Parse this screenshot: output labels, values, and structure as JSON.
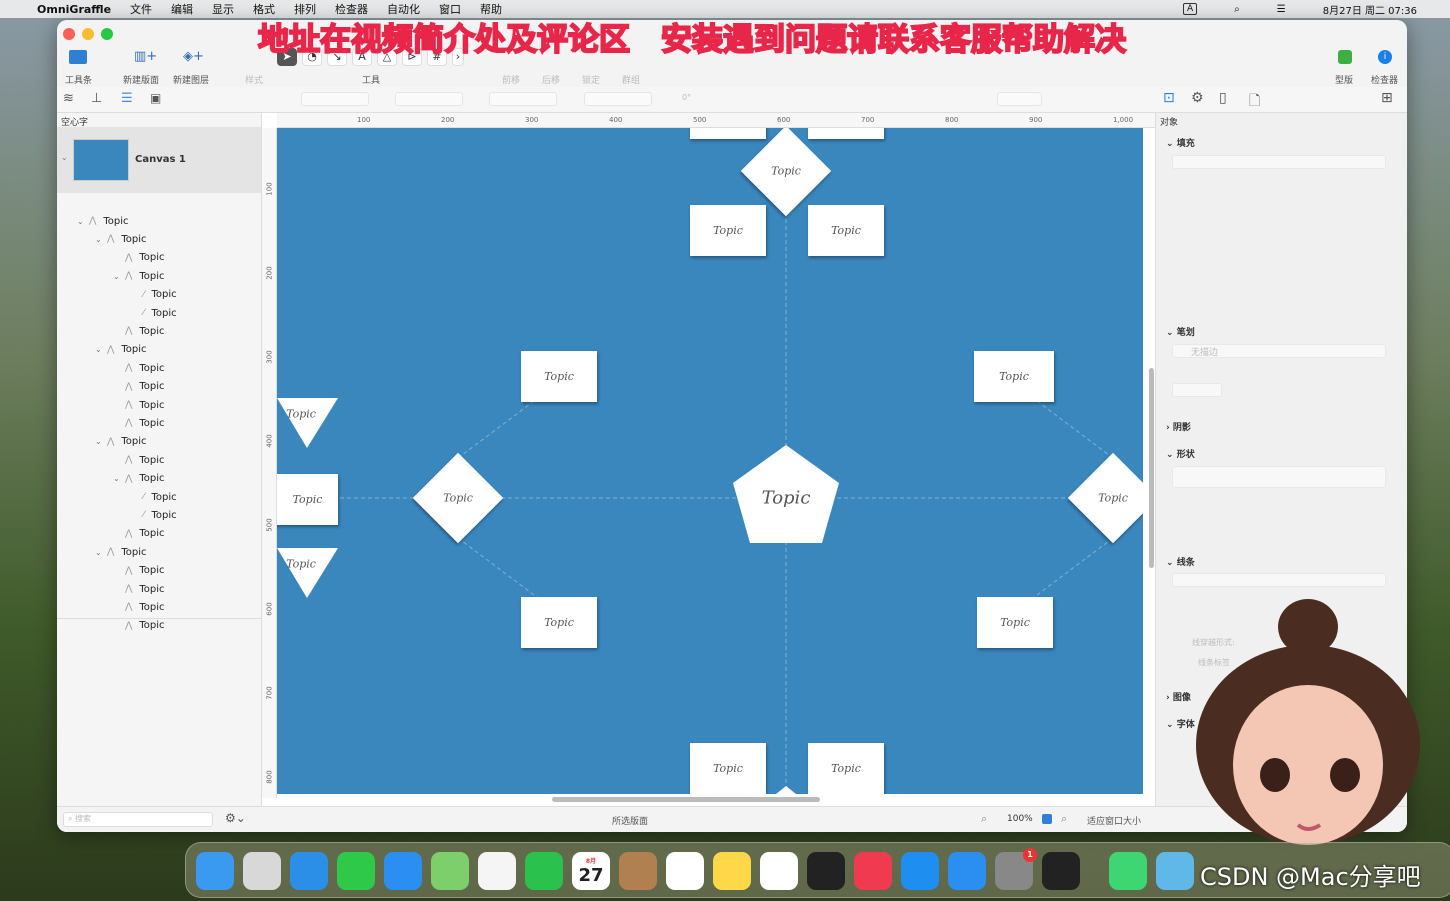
{
  "menubar": {
    "app": "OmniGraffle",
    "items": [
      "文件",
      "编辑",
      "显示",
      "格式",
      "排列",
      "检查器",
      "自动化",
      "窗口",
      "帮助"
    ],
    "input_indicator": "A",
    "datetime": "8月27日 周二 07:36"
  },
  "banner": "地址在视频简介处及评论区　安装遇到问题请联系客服帮助解决",
  "toolbar": {
    "toolbar_label": "工具条",
    "new_canvas": "新建版面",
    "new_layer": "新建图层",
    "style": "样式",
    "tools": "工具",
    "forward": "前移",
    "backward": "后移",
    "lock": "锁定",
    "group": "群组",
    "templates": "型版",
    "inspector": "检查器"
  },
  "subbar": {
    "angle": "0°"
  },
  "sidebar": {
    "title": "空心字",
    "canvas_name": "Canvas 1",
    "outline": [
      {
        "label": "Topic",
        "level": 0,
        "open": true
      },
      {
        "label": "Topic",
        "level": 1,
        "open": true
      },
      {
        "label": "Topic",
        "level": 2
      },
      {
        "label": "Topic",
        "level": 2,
        "open": true
      },
      {
        "label": "Topic",
        "level": 3
      },
      {
        "label": "Topic",
        "level": 3
      },
      {
        "label": "Topic",
        "level": 2
      },
      {
        "label": "Topic",
        "level": 1,
        "open": true
      },
      {
        "label": "Topic",
        "level": 2
      },
      {
        "label": "Topic",
        "level": 2
      },
      {
        "label": "Topic",
        "level": 2
      },
      {
        "label": "Topic",
        "level": 2
      },
      {
        "label": "Topic",
        "level": 1,
        "open": true
      },
      {
        "label": "Topic",
        "level": 2
      },
      {
        "label": "Topic",
        "level": 2,
        "open": true
      },
      {
        "label": "Topic",
        "level": 3
      },
      {
        "label": "Topic",
        "level": 3
      },
      {
        "label": "Topic",
        "level": 2
      },
      {
        "label": "Topic",
        "level": 1,
        "open": true
      },
      {
        "label": "Topic",
        "level": 2
      },
      {
        "label": "Topic",
        "level": 2
      },
      {
        "label": "Topic",
        "level": 2
      },
      {
        "label": "Topic",
        "level": 2
      }
    ]
  },
  "ruler": {
    "h": [
      "100",
      "200",
      "300",
      "400",
      "500",
      "600",
      "700",
      "800",
      "900",
      "1,000"
    ],
    "v": [
      "100",
      "200",
      "300",
      "400",
      "500",
      "600",
      "700",
      "800"
    ]
  },
  "canvas": {
    "background": "#3a87be",
    "center_label": "Topic",
    "labels": [
      "Topic",
      "Topic",
      "Topic",
      "Topic",
      "Topic",
      "Topic",
      "Topic",
      "Topic",
      "Topic",
      "Topic",
      "Topic",
      "Topic",
      "Topic",
      "Topic",
      "Topic",
      "Topic"
    ]
  },
  "inspector": {
    "tab": "对象",
    "fill": "填充",
    "stroke": "笔划",
    "no_stroke": "无描边",
    "shadow": "阴影",
    "shape": "形状",
    "lines": "线条",
    "line_hop": "线穿越形式:",
    "line_label": "线条标签",
    "image": "图像",
    "font": "字体"
  },
  "status": {
    "search_placeholder": "搜索",
    "selected": "所选版面",
    "zoom": "100%",
    "fit": "适应窗口大小"
  },
  "dock": [
    "Finder",
    "Launchpad",
    "Safari",
    "Messages",
    "Mail",
    "Maps",
    "Photos",
    "FaceTime",
    "Calendar",
    "Contacts",
    "Reminders",
    "Notes",
    "Freeform",
    "TV",
    "Music",
    "App Store",
    "Instruments",
    "System Settings",
    "Terminal",
    "OmniGraffle",
    "Folder"
  ],
  "dock_calendar": {
    "month": "8月",
    "day": "27"
  },
  "dock_badge": "1",
  "watermark": "CSDN @Mac分享吧"
}
